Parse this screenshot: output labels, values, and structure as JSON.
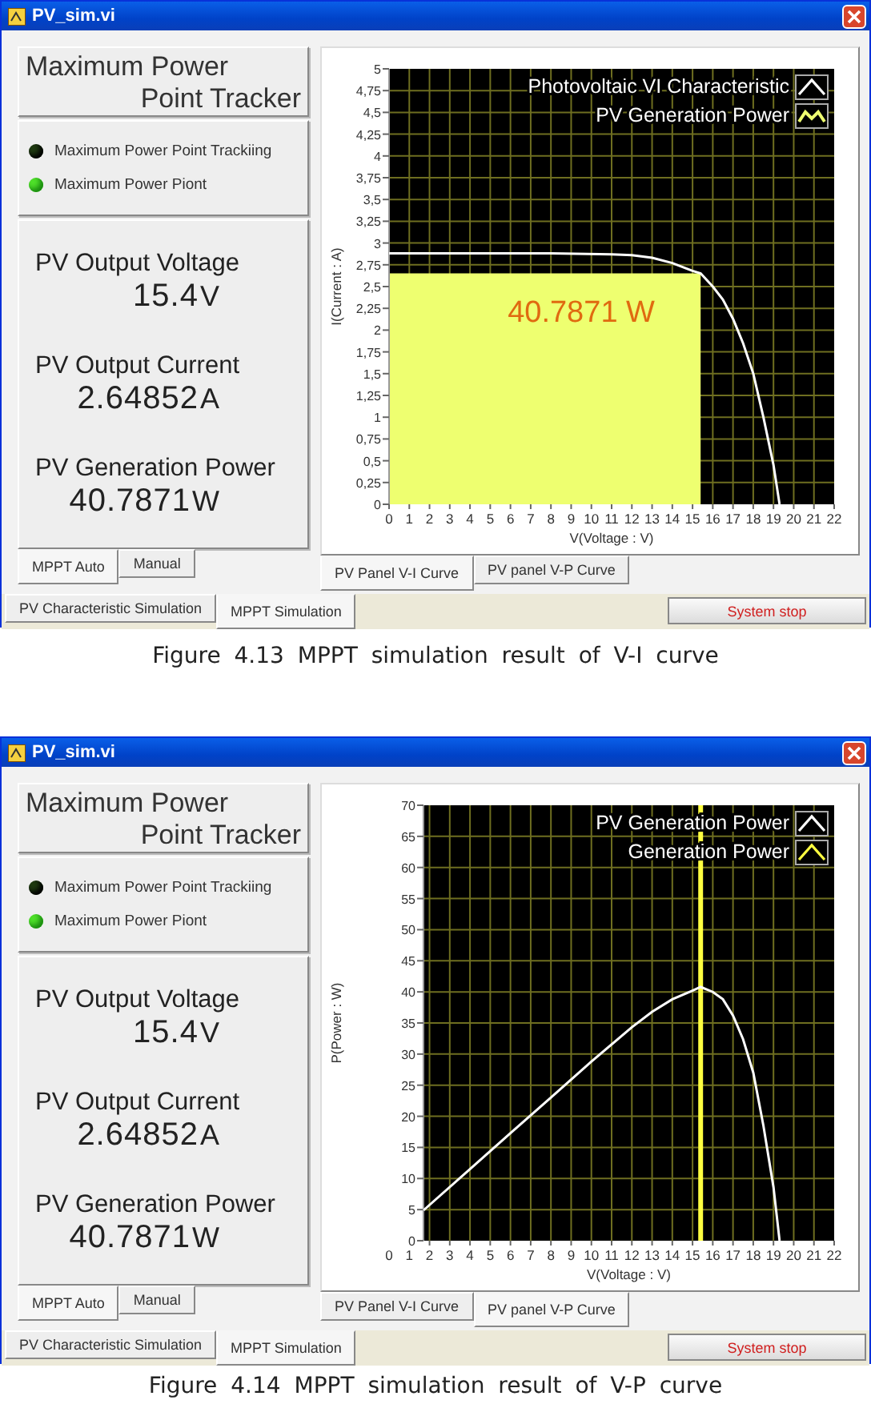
{
  "figures": [
    {
      "window": {
        "title": "PV_sim.vi",
        "panel_title": [
          "Maximum Power",
          "Point Tracker"
        ],
        "indicators": [
          {
            "label": "Maximum Power Point Trackiing",
            "on": false
          },
          {
            "label": "Maximum Power Piont",
            "on": true
          }
        ],
        "readings": [
          {
            "label": "PV Output Voltage",
            "value": "15.4",
            "unit": "V"
          },
          {
            "label": "PV Output Current",
            "value": "2.64852",
            "unit": "A"
          },
          {
            "label": "PV Generation Power",
            "value": "40.7871",
            "unit": "W"
          }
        ],
        "mode_tabs": [
          {
            "label": "MPPT Auto",
            "selected": true
          },
          {
            "label": "Manual",
            "selected": false
          }
        ],
        "graph": {
          "legend_icons": [
            {
              "kind": "peak"
            },
            {
              "kind": "wave"
            }
          ],
          "chart_data": {
            "type": "line",
            "xlabel": "V(Voltage : V)",
            "ylabel": "I(Current : A)",
            "grid": true,
            "x": [
              0,
              4,
              8,
              11,
              12,
              13,
              14,
              15,
              15.4,
              16,
              16.5,
              17,
              17.5,
              18,
              18.5,
              19,
              19.3
            ],
            "series": [
              {
                "name": "Photovoltaic VI Characteristic",
                "color": "#ffffff",
                "values": [
                  2.88,
                  2.88,
                  2.88,
                  2.87,
                  2.86,
                  2.83,
                  2.77,
                  2.68,
                  2.65,
                  2.5,
                  2.35,
                  2.13,
                  1.85,
                  1.5,
                  1.0,
                  0.45,
                  0
                ]
              },
              {
                "name": "PV Generation Power",
                "type": "area",
                "color": "#eeff70",
                "values": [
                  2.65,
                  2.65,
                  2.65,
                  2.65,
                  2.65,
                  2.65,
                  2.65,
                  2.65,
                  2.65,
                  null,
                  null,
                  null,
                  null,
                  null,
                  null,
                  null,
                  null
                ]
              }
            ],
            "xlim": [
              0,
              22
            ],
            "ylim": [
              0,
              5
            ],
            "xticks": [
              0,
              1,
              2,
              3,
              4,
              5,
              6,
              7,
              8,
              9,
              10,
              11,
              12,
              13,
              14,
              15,
              16,
              17,
              18,
              19,
              20,
              21,
              22
            ],
            "yticks": [
              0,
              {
                "value": 0.25,
                "label": "0,25"
              },
              {
                "value": 0.5,
                "label": "0,5"
              },
              {
                "value": 0.75,
                "label": "0,75"
              },
              1,
              {
                "value": 1.25,
                "label": "1,25"
              },
              {
                "value": 1.5,
                "label": "1,5"
              },
              {
                "value": 1.75,
                "label": "1,75"
              },
              2,
              {
                "value": 2.25,
                "label": "2,25"
              },
              {
                "value": 2.5,
                "label": "2,5"
              },
              {
                "value": 2.75,
                "label": "2,75"
              },
              3,
              {
                "value": 3.25,
                "label": "3,25"
              },
              {
                "value": 3.5,
                "label": "3,5"
              },
              {
                "value": 3.75,
                "label": "3,75"
              },
              4,
              {
                "value": 4.25,
                "label": "4,25"
              },
              {
                "value": 4.5,
                "label": "4,5"
              },
              {
                "value": 4.75,
                "label": "4,75"
              },
              5
            ],
            "legend": "upper right",
            "annotations": [
              "40.7871 W"
            ]
          }
        },
        "graph_tabs": [
          {
            "label": "PV Panel V-I Curve",
            "selected": true
          },
          {
            "label": "PV panel V-P Curve",
            "selected": false
          }
        ],
        "main_tabs": [
          {
            "label": "PV Characteristic Simulation",
            "selected": false
          },
          {
            "label": "MPPT Simulation",
            "selected": true
          }
        ],
        "stop_button": "System stop"
      },
      "caption": "Figure 4.13 MPPT simulation result of V-I curve"
    },
    {
      "window": {
        "title": "PV_sim.vi",
        "panel_title": [
          "Maximum Power",
          "Point Tracker"
        ],
        "indicators": [
          {
            "label": "Maximum Power Point Trackiing",
            "on": false
          },
          {
            "label": "Maximum Power Piont",
            "on": true
          }
        ],
        "readings": [
          {
            "label": "PV Output Voltage",
            "value": "15.4",
            "unit": "V"
          },
          {
            "label": "PV Output Current",
            "value": "2.64852",
            "unit": "A"
          },
          {
            "label": "PV Generation Power",
            "value": "40.7871",
            "unit": "W"
          }
        ],
        "mode_tabs": [
          {
            "label": "MPPT Auto",
            "selected": true
          },
          {
            "label": "Manual",
            "selected": false
          }
        ],
        "graph": {
          "legend_icons": [
            {
              "kind": "peak"
            },
            {
              "kind": "peak"
            }
          ],
          "chart_data": {
            "type": "line",
            "xlabel": "V(Voltage : V)",
            "ylabel": "P(Power : W)",
            "grid": true,
            "x": [
              1.7,
              4,
              6,
              8,
              10,
              12,
              13,
              14,
              15,
              15.4,
              16,
              16.5,
              17,
              17.5,
              18,
              18.5,
              19,
              19.3
            ],
            "series": [
              {
                "name": "PV Generation Power",
                "color": "#ffffff",
                "values": [
                  4.9,
                  11.5,
                  17.3,
                  23,
                  28.8,
                  34.3,
                  36.8,
                  38.8,
                  40.2,
                  40.8,
                  40,
                  38.8,
                  36.2,
                  32.4,
                  27,
                  18.5,
                  8.6,
                  0
                ]
              }
            ],
            "xlim": [
              0,
              22
            ],
            "ylim": [
              0,
              70
            ],
            "xticks": [
              0,
              1,
              2,
              3,
              4,
              5,
              6,
              7,
              8,
              9,
              10,
              11,
              12,
              13,
              14,
              15,
              16,
              17,
              18,
              19,
              20,
              21,
              22
            ],
            "yticks": [
              0,
              5,
              10,
              15,
              20,
              25,
              30,
              35,
              40,
              45,
              50,
              55,
              60,
              65,
              70
            ],
            "legend": "upper right",
            "ref_lines": [
              {
                "axis": "x",
                "value": 15.4,
                "label": "Generation Power",
                "color": "#ffff40"
              }
            ]
          }
        },
        "graph_tabs": [
          {
            "label": "PV Panel V-I Curve",
            "selected": false
          },
          {
            "label": "PV panel V-P Curve",
            "selected": true
          }
        ],
        "main_tabs": [
          {
            "label": "PV Characteristic Simulation",
            "selected": false
          },
          {
            "label": "MPPT Simulation",
            "selected": true
          }
        ],
        "stop_button": "System stop"
      },
      "caption": "Figure 4.14 MPPT simulation result of V-P curve"
    }
  ]
}
